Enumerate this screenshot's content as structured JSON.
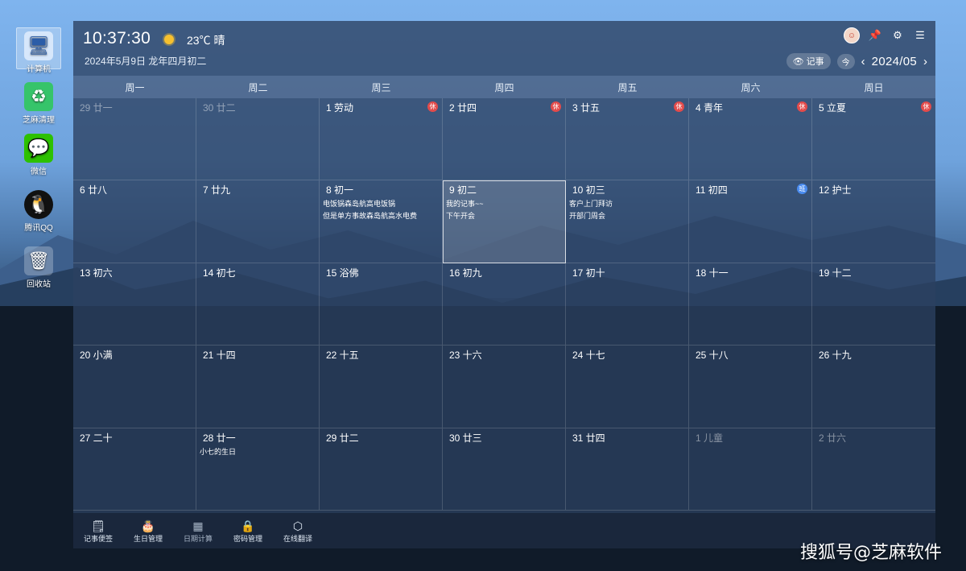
{
  "desktop_icons": [
    {
      "label": "计算机",
      "icon": "computer-icon"
    },
    {
      "label": "芝麻清理",
      "icon": "cleaner-icon"
    },
    {
      "label": "微信",
      "icon": "wechat-icon"
    },
    {
      "label": "腾讯QQ",
      "icon": "qq-icon"
    },
    {
      "label": "回收站",
      "icon": "recycle-bin-icon"
    }
  ],
  "header": {
    "clock": "10:37:30",
    "weather_icon": "sun-icon",
    "temp": "23℃ 晴",
    "date": "2024年5月9日 龙年四月初二",
    "notes_button": "记事",
    "today_button": "今",
    "month": "2024/05"
  },
  "weekdays": [
    "周一",
    "周二",
    "周三",
    "周四",
    "周五",
    "周六",
    "周日"
  ],
  "weeks": [
    [
      {
        "day": "29 廿一",
        "other": true
      },
      {
        "day": "30 廿二",
        "other": true
      },
      {
        "day": "1 劳动",
        "badge": "休"
      },
      {
        "day": "2 廿四",
        "badge": "休"
      },
      {
        "day": "3 廿五",
        "badge": "休"
      },
      {
        "day": "4 青年",
        "badge": "休"
      },
      {
        "day": "5 立夏",
        "badge": "休"
      }
    ],
    [
      {
        "day": "6 廿八"
      },
      {
        "day": "7 廿九"
      },
      {
        "day": "8 初一",
        "notes": [
          "电饭锅森岛航高电饭锅",
          "但是单方事故森岛航高水电费"
        ]
      },
      {
        "day": "9 初二",
        "today": true,
        "notes": [
          "我的记事~~",
          "下午开会"
        ]
      },
      {
        "day": "10 初三",
        "notes": [
          "客户上门拜访",
          "开部门周会"
        ]
      },
      {
        "day": "11 初四",
        "badge": "班",
        "work": true
      },
      {
        "day": "12 护士"
      }
    ],
    [
      {
        "day": "13 初六"
      },
      {
        "day": "14 初七"
      },
      {
        "day": "15 浴佛"
      },
      {
        "day": "16 初九"
      },
      {
        "day": "17 初十"
      },
      {
        "day": "18 十一"
      },
      {
        "day": "19 十二"
      }
    ],
    [
      {
        "day": "20 小满"
      },
      {
        "day": "21 十四"
      },
      {
        "day": "22 十五"
      },
      {
        "day": "23 十六"
      },
      {
        "day": "24 十七"
      },
      {
        "day": "25 十八"
      },
      {
        "day": "26 十九"
      }
    ],
    [
      {
        "day": "27 二十"
      },
      {
        "day": "28 廿一",
        "notes": [
          "小七的生日"
        ]
      },
      {
        "day": "29 廿二"
      },
      {
        "day": "30 廿三"
      },
      {
        "day": "31 廿四"
      },
      {
        "day": "1 儿童",
        "other": true
      },
      {
        "day": "2 廿六",
        "other": true
      }
    ]
  ],
  "toolbar": [
    {
      "label": "记事便签",
      "icon": "notepad-icon"
    },
    {
      "label": "生日管理",
      "icon": "cake-icon"
    },
    {
      "label": "日期计算",
      "icon": "calculator-icon",
      "dim": true
    },
    {
      "label": "密码管理",
      "icon": "lock-icon"
    },
    {
      "label": "在线翻译",
      "icon": "translate-icon"
    }
  ],
  "watermark": "搜狐号@芝麻软件"
}
